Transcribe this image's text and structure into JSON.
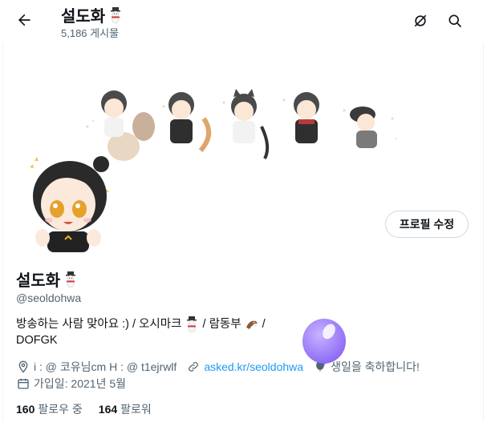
{
  "header": {
    "title": "설도화",
    "post_count": "5,186 게시물"
  },
  "profile": {
    "name": "설도화",
    "handle": "@seoldohwa",
    "edit_button": "프로필 수정",
    "bio_line1_a": "방송하는 사람 맞아요 :) / 오시마크",
    "bio_line1_b": "/ 람동부",
    "bio_line1_c": "/",
    "bio_line2": "DOFGK",
    "location": "i : @ 코유님cm H : @ t1ejrwlf",
    "link": "asked.kr/seoldohwa",
    "birthday": "생일을 축하합니다!",
    "joined": "가입일: 2021년 5월"
  },
  "stats": {
    "following_count": "160",
    "following_label": "팔로우 중",
    "followers_count": "164",
    "followers_label": "팔로워"
  },
  "colors": {
    "link": "#1d9bf0",
    "muted": "#536471",
    "balloon": "#9b7bf7"
  }
}
